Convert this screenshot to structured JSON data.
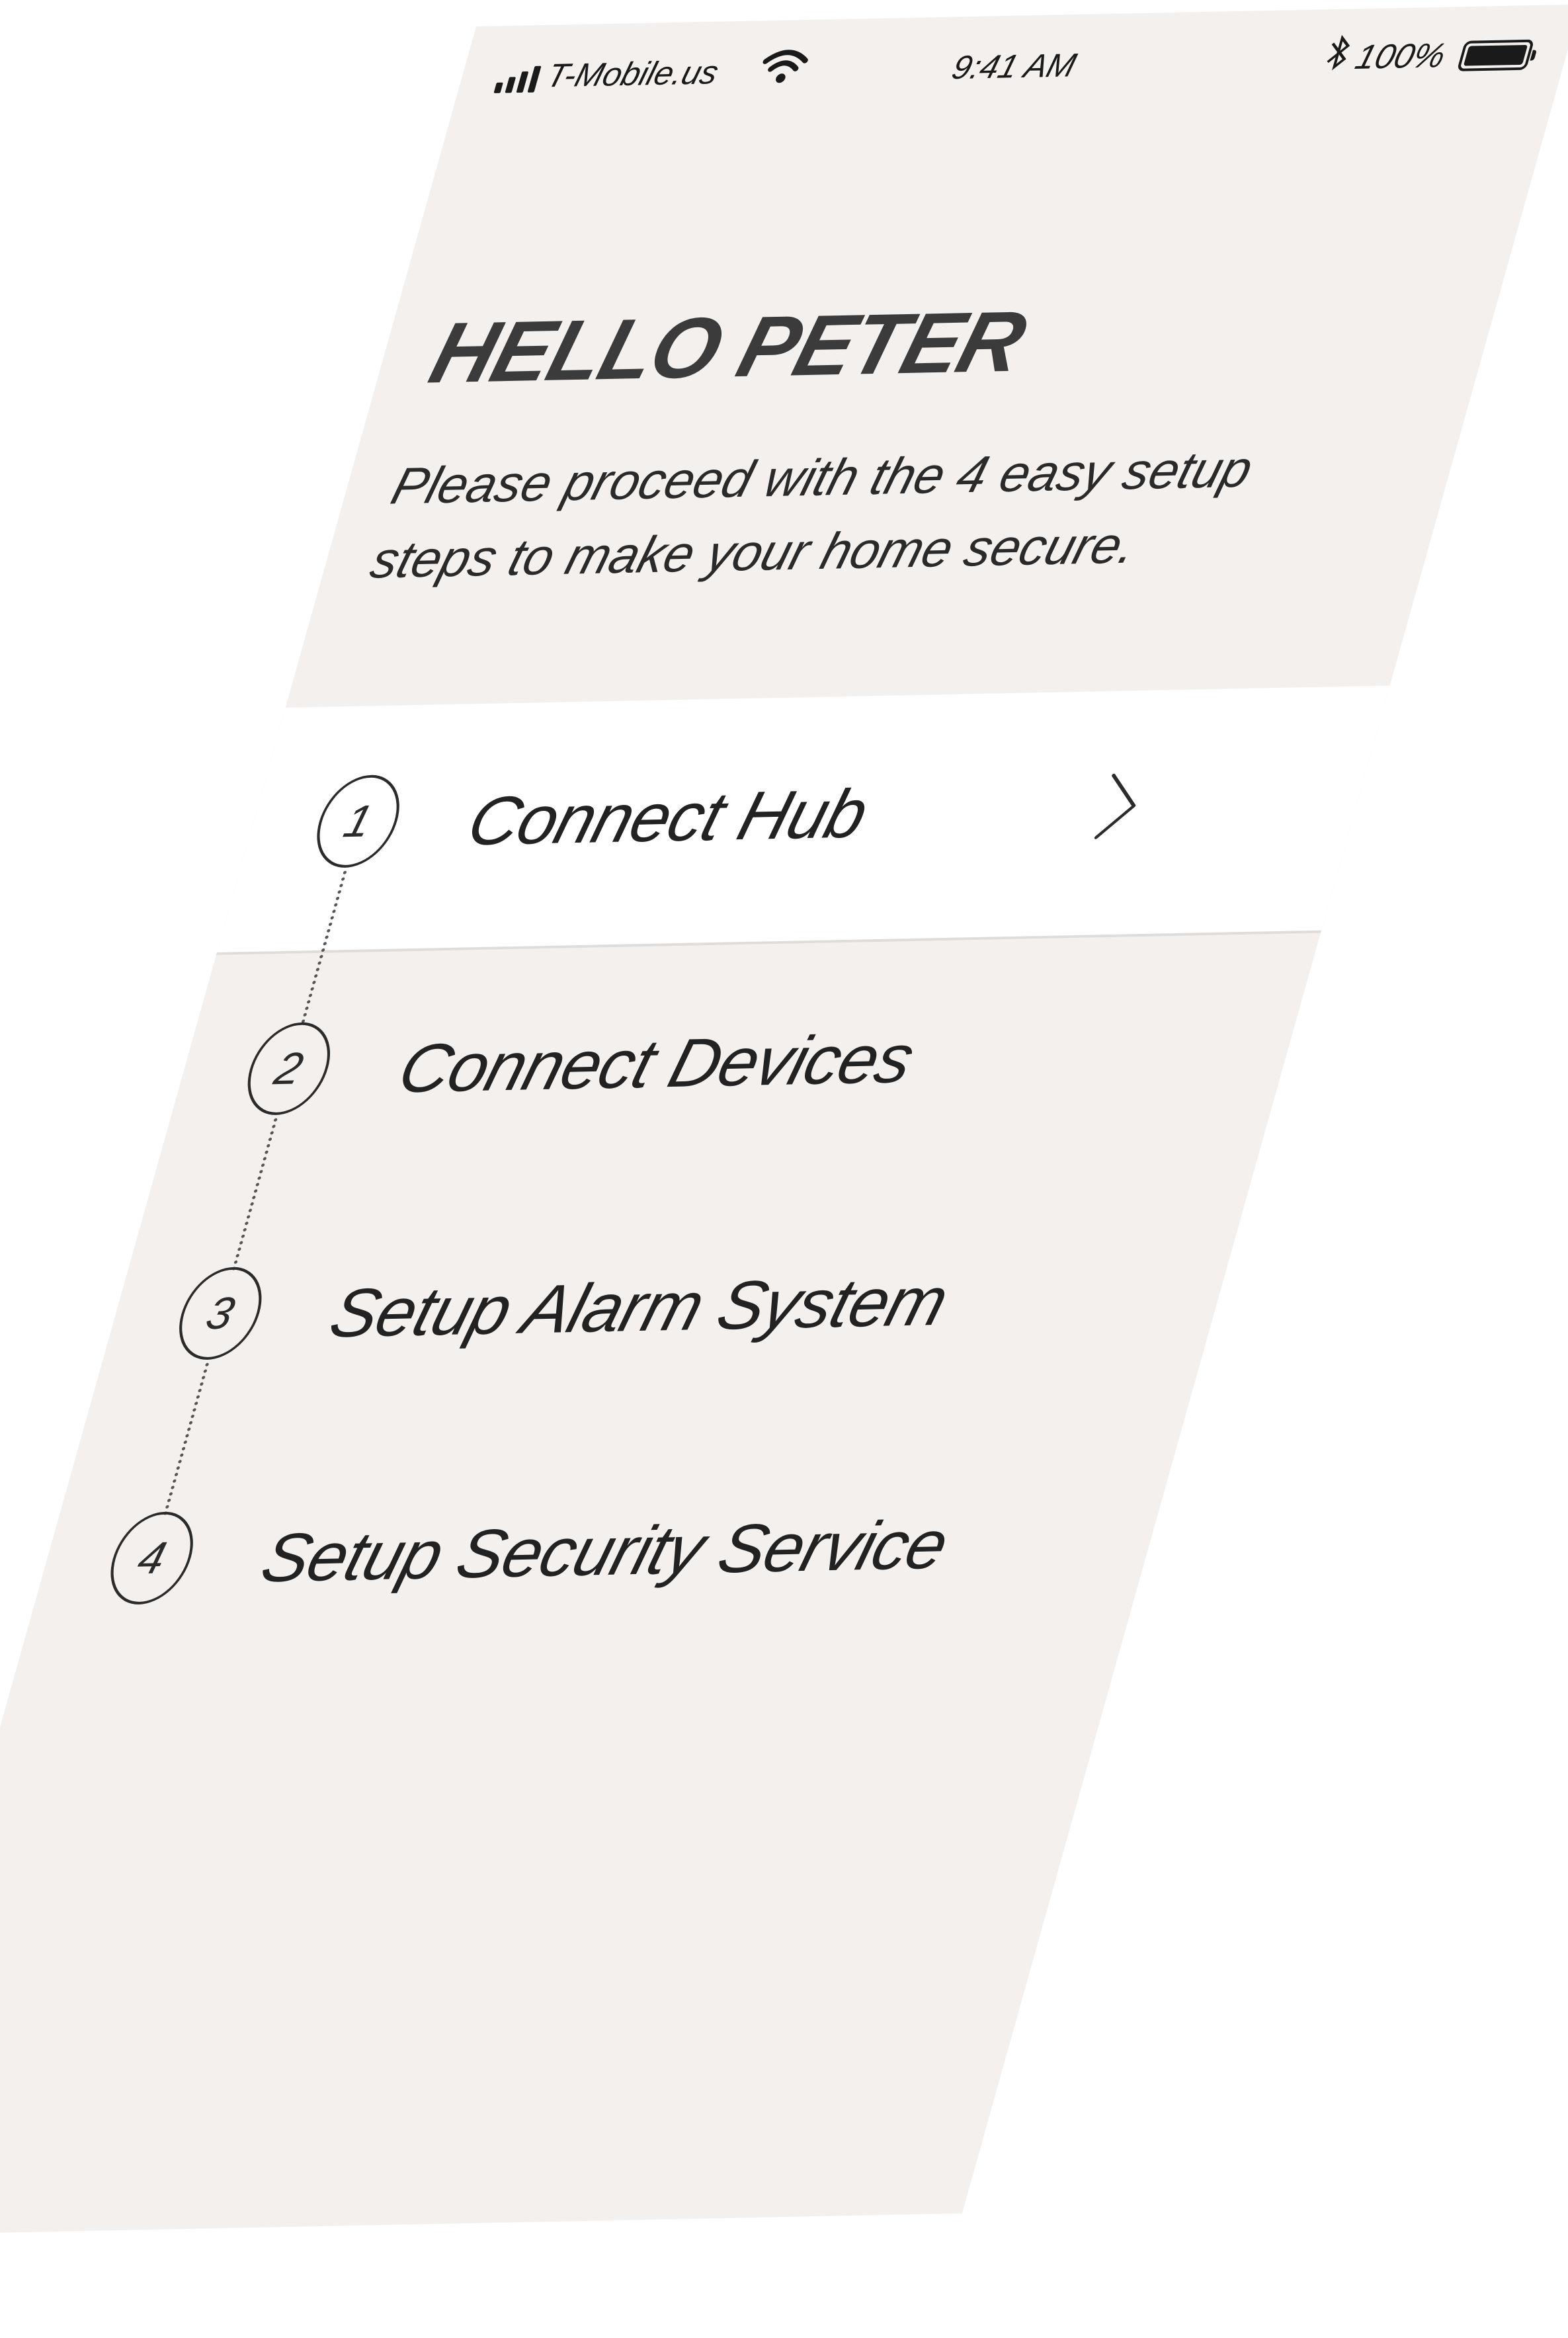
{
  "status_bar": {
    "carrier": "T-Mobile.us",
    "time": "9:41 AM",
    "battery": "100%",
    "icons": [
      "signal-icon",
      "wifi-icon",
      "bluetooth-icon",
      "battery-icon"
    ]
  },
  "greeting": {
    "title": "HELLO PETER",
    "subtitle": "Please proceed with the 4 easy setup steps to make your home secure."
  },
  "steps": [
    {
      "number": "1",
      "label": "Connect Hub",
      "active": true
    },
    {
      "number": "2",
      "label": "Connect Devices",
      "active": false
    },
    {
      "number": "3",
      "label": "Setup Alarm System",
      "active": false
    },
    {
      "number": "4",
      "label": "Setup Security Service",
      "active": false
    }
  ],
  "colors": {
    "background": "#f4f0ee",
    "active_row": "#ffffff",
    "text": "#222222"
  }
}
